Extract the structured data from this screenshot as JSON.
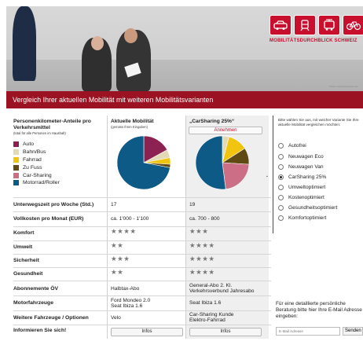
{
  "header": {
    "brand": "MOBILITÄTSDURCHBLICK SCHWEIZ",
    "photo_credit": "Photo: www.photocase.com",
    "logo_icons": [
      "car-icon",
      "train-icon",
      "tram-icon",
      "bicycle-icon"
    ],
    "accent_color": "#c8102e"
  },
  "banner": {
    "title": "Vergleich Ihrer aktuellen Mobilität mit weiteren Mobilitätsvarianten",
    "color": "#9b1322"
  },
  "legend": {
    "title": "Personenkilometer-Anteile pro Verkehrsmittel",
    "subtitle": "(total für alle Personen im Haushalt)",
    "items": [
      {
        "label": "Auto",
        "color": "#8b2252"
      },
      {
        "label": "Bahn/Bus",
        "color": "#e2dab4"
      },
      {
        "label": "Fahrrad",
        "color": "#f1c40f"
      },
      {
        "label": "Zu Fuss",
        "color": "#5e4a12"
      },
      {
        "label": "Car-Sharing",
        "color": "#cc6f86"
      },
      {
        "label": "Motorrad/Roller",
        "color": "#0d5a86"
      }
    ]
  },
  "columns": {
    "current": {
      "title": "Aktuelle Mobilität",
      "subtitle": "(gemäss Ihren Eingaben)"
    },
    "variant": {
      "title": "„CarSharing 25%“",
      "accept_label": "Annehmen"
    }
  },
  "chart_data": [
    {
      "type": "pie",
      "categories": [
        "Auto",
        "Bahn/Bus",
        "Fahrrad",
        "Zu Fuss",
        "Car-Sharing",
        "Motorrad/Roller"
      ],
      "values": [
        17,
        5,
        4,
        2,
        0,
        72
      ]
    },
    {
      "type": "pie",
      "categories": [
        "Auto",
        "Bahn/Bus",
        "Fahrrad",
        "Zu Fuss",
        "Car-Sharing",
        "Motorrad/Roller"
      ],
      "values": [
        0,
        4,
        12,
        10,
        22,
        52
      ]
    }
  ],
  "rows": [
    {
      "label": "Unterwegszeit pro Woche (Std.)",
      "v1": "17",
      "v2": "19"
    },
    {
      "label": "Vollkosten pro Monat (EUR)",
      "v1": "ca. 1'000 - 1'100",
      "v2": "ca. 700 - 800"
    },
    {
      "label": "Komfort",
      "v1": "★★★★",
      "v2": "★★★"
    },
    {
      "label": "Umwelt",
      "v1": "★★",
      "v2": "★★★★"
    },
    {
      "label": "Sicherheit",
      "v1": "★★★",
      "v2": "★★★★"
    },
    {
      "label": "Gesundheit",
      "v1": "★★",
      "v2": "★★★★"
    },
    {
      "label": "Abonnemente ÖV",
      "v1": "Halbtax-Abo",
      "v2": "General-Abo 2. Kl.\nVerkehrsverbund Jahresabo"
    },
    {
      "label": "Motorfahrzeuge",
      "v1": "Ford Mondeo 2.0\nSeat Ibiza 1.6",
      "v2": "Seat Ibiza 1.6"
    },
    {
      "label": "Weitere Fahrzeuge / Optionen",
      "v1": "Velo",
      "v2": "Car-Sharing Kunde\nElektro-Fahrrad"
    },
    {
      "label": "Informieren Sie sich!",
      "v1_button": "Infos",
      "v2_button": "Infos"
    }
  ],
  "right_panel": {
    "intro": "Bitte wählen Sie aus, mit welcher Variante Sie Ihre aktuelle Mobilität vergleichen möchten:",
    "options": [
      {
        "label": "Autofrei",
        "selected": false
      },
      {
        "label": "Neuwagen Eco",
        "selected": false
      },
      {
        "label": "Neuwagen Van",
        "selected": false
      },
      {
        "label": "CarSharing 25%",
        "selected": true
      },
      {
        "label": "Umweltoptimiert",
        "selected": false
      },
      {
        "label": "Kostenoptimiert",
        "selected": false
      },
      {
        "label": "Gesundheitsoptimiert",
        "selected": false
      },
      {
        "label": "Komfortoptimiert",
        "selected": false
      }
    ],
    "email_text": "Für eine detaillierte persönliche Beratung bitte hier Ihre E-Mail Adresse eingeben:",
    "email_placeholder": "E-Mail Adresse",
    "send_label": "Senden"
  }
}
